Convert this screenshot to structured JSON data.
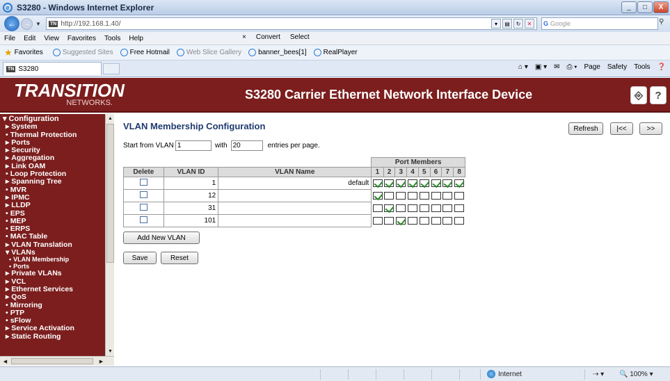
{
  "window": {
    "title": "S3280 - Windows Internet Explorer",
    "buttons": [
      "_",
      "□",
      "X"
    ]
  },
  "address": {
    "url": "http://192.168.1.40/",
    "search_placeholder": "Google"
  },
  "menu": {
    "items": [
      "File",
      "Edit",
      "View",
      "Favorites",
      "Tools",
      "Help"
    ],
    "convert_label": "Convert",
    "select_label": "Select"
  },
  "favorites": {
    "label": "Favorites",
    "items": [
      "Suggested Sites",
      "Free Hotmail",
      "Web Slice Gallery",
      "banner_bees[1]",
      "RealPlayer"
    ]
  },
  "tab": {
    "title": "S3280"
  },
  "commandbar": {
    "page": "Page",
    "safety": "Safety",
    "tools": "Tools"
  },
  "device": {
    "logo_main": "TRANSITION",
    "logo_sub": "NETWORKS.",
    "title": "S3280 Carrier Ethernet Network Interface Device"
  },
  "sidebar": {
    "items": [
      {
        "label": "Configuration",
        "level": "top",
        "marker": "▾"
      },
      {
        "label": "System",
        "level": "l1",
        "marker": "▸"
      },
      {
        "label": "Thermal Protection",
        "level": "l1",
        "marker": "•"
      },
      {
        "label": "Ports",
        "level": "l1",
        "marker": "▸"
      },
      {
        "label": "Security",
        "level": "l1",
        "marker": "▸"
      },
      {
        "label": "Aggregation",
        "level": "l1",
        "marker": "▸"
      },
      {
        "label": "Link OAM",
        "level": "l1",
        "marker": "▸"
      },
      {
        "label": "Loop Protection",
        "level": "l1",
        "marker": "•"
      },
      {
        "label": "Spanning Tree",
        "level": "l1",
        "marker": "▸"
      },
      {
        "label": "MVR",
        "level": "l1",
        "marker": "•"
      },
      {
        "label": "IPMC",
        "level": "l1",
        "marker": "▸"
      },
      {
        "label": "LLDP",
        "level": "l1",
        "marker": "▸"
      },
      {
        "label": "EPS",
        "level": "l1",
        "marker": "•"
      },
      {
        "label": "MEP",
        "level": "l1",
        "marker": "•"
      },
      {
        "label": "ERPS",
        "level": "l1",
        "marker": "•"
      },
      {
        "label": "MAC Table",
        "level": "l1",
        "marker": "•"
      },
      {
        "label": "VLAN Translation",
        "level": "l1",
        "marker": "▸"
      },
      {
        "label": "VLANs",
        "level": "l1",
        "marker": "▾"
      },
      {
        "label": "VLAN Membership",
        "level": "l2",
        "marker": "•"
      },
      {
        "label": "Ports",
        "level": "l2",
        "marker": "•"
      },
      {
        "label": "Private VLANs",
        "level": "l1",
        "marker": "▸"
      },
      {
        "label": "VCL",
        "level": "l1",
        "marker": "▸"
      },
      {
        "label": "Ethernet Services",
        "level": "l1",
        "marker": "▸"
      },
      {
        "label": "QoS",
        "level": "l1",
        "marker": "▸"
      },
      {
        "label": "Mirroring",
        "level": "l1",
        "marker": "•"
      },
      {
        "label": "PTP",
        "level": "l1",
        "marker": "•"
      },
      {
        "label": "sFlow",
        "level": "l1",
        "marker": "•"
      },
      {
        "label": "Service Activation",
        "level": "l1",
        "marker": "▸"
      },
      {
        "label": "Static Routing",
        "level": "l1",
        "marker": "▸"
      }
    ]
  },
  "main": {
    "title": "VLAN Membership Configuration",
    "refresh": "Refresh",
    "first": "|<<",
    "next": ">>",
    "start_label": "Start from VLAN",
    "start_value": "1",
    "with_label": "with",
    "with_value": "20",
    "entries_label": "entries per page.",
    "table": {
      "port_members_header": "Port Members",
      "col_delete": "Delete",
      "col_vlan_id": "VLAN ID",
      "col_vlan_name": "VLAN Name",
      "ports": [
        "1",
        "2",
        "3",
        "4",
        "5",
        "6",
        "7",
        "8"
      ],
      "rows": [
        {
          "vlan_id": "1",
          "name": "default",
          "members": [
            true,
            true,
            true,
            true,
            true,
            true,
            true,
            true
          ]
        },
        {
          "vlan_id": "12",
          "name": "",
          "members": [
            true,
            false,
            false,
            false,
            false,
            false,
            false,
            false
          ]
        },
        {
          "vlan_id": "31",
          "name": "",
          "members": [
            false,
            true,
            false,
            false,
            false,
            false,
            false,
            false
          ]
        },
        {
          "vlan_id": "101",
          "name": "",
          "members": [
            false,
            false,
            true,
            false,
            false,
            false,
            false,
            false
          ]
        }
      ]
    },
    "add_new_vlan": "Add New VLAN",
    "save": "Save",
    "reset": "Reset"
  },
  "status": {
    "zone": "Internet",
    "zoom": "100%"
  },
  "colors": {
    "header_bg": "#7c1e1e",
    "title_color": "#1f3a6e",
    "check_color": "#2d8a2d"
  }
}
